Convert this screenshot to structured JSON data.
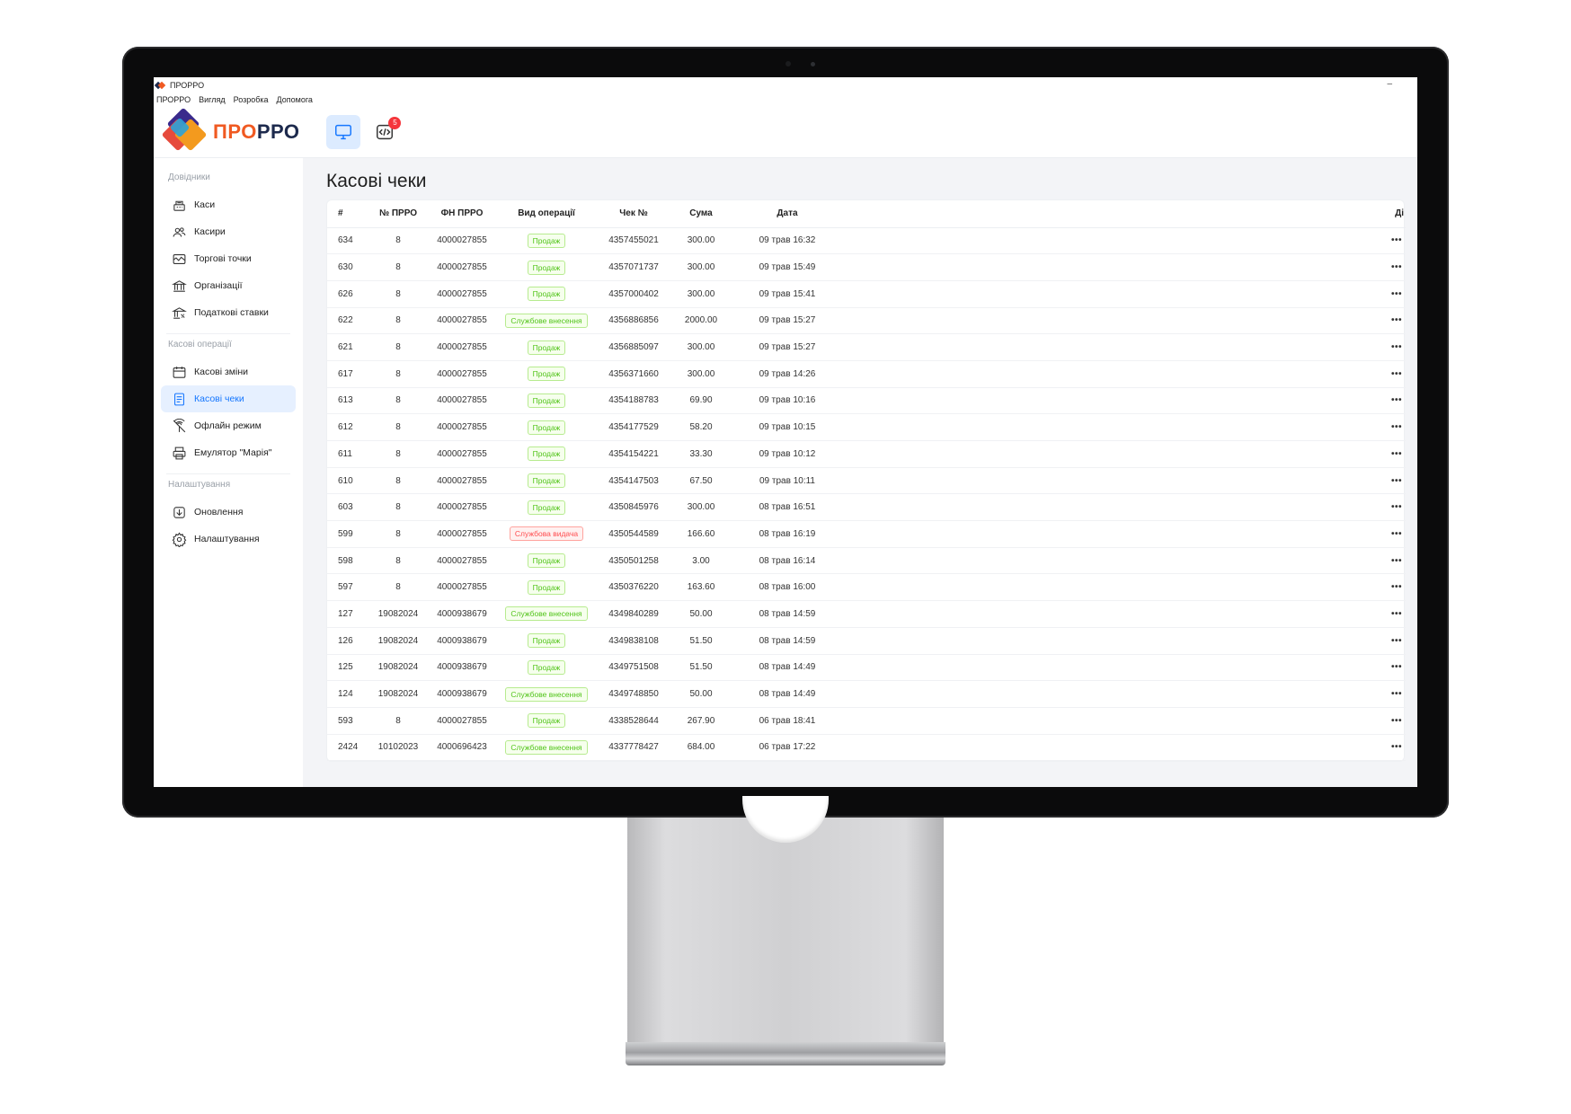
{
  "window": {
    "title": "ПРОРРО",
    "minimize": "–"
  },
  "menu": [
    "ПРОРРО",
    "Вигляд",
    "Розробка",
    "Допомога"
  ],
  "brand": {
    "part1": "ПРО",
    "part2": "РРО"
  },
  "header": {
    "notifications_count": "5"
  },
  "sidebar": {
    "groups": [
      {
        "label": "Довідники",
        "items": [
          {
            "label": "Каси",
            "icon": "cash-register-icon"
          },
          {
            "label": "Касири",
            "icon": "users-icon"
          },
          {
            "label": "Торгові точки",
            "icon": "shop-icon"
          },
          {
            "label": "Організації",
            "icon": "bank-icon"
          },
          {
            "label": "Податкові ставки",
            "icon": "tax-icon"
          }
        ]
      },
      {
        "label": "Касові операції",
        "items": [
          {
            "label": "Касові зміни",
            "icon": "calendar-icon"
          },
          {
            "label": "Касові чеки",
            "icon": "receipt-icon",
            "active": true
          },
          {
            "label": "Офлайн режим",
            "icon": "offline-icon"
          },
          {
            "label": "Емулятор \"Марія\"",
            "icon": "printer-icon"
          }
        ]
      },
      {
        "label": "Налаштування",
        "items": [
          {
            "label": "Оновлення",
            "icon": "download-icon"
          },
          {
            "label": "Налаштування",
            "icon": "gear-icon"
          }
        ]
      }
    ]
  },
  "main": {
    "title": "Касові чеки"
  },
  "table": {
    "columns": [
      "#",
      "№ ПРРО",
      "ФН ПРРО",
      "Вид операції",
      "Чек №",
      "Сума",
      "Дата",
      "Ді"
    ],
    "rows": [
      [
        "634",
        "8",
        "4000027855",
        "Продаж",
        "4357455021",
        "300.00",
        "09 трав 16:32"
      ],
      [
        "630",
        "8",
        "4000027855",
        "Продаж",
        "4357071737",
        "300.00",
        "09 трав 15:49"
      ],
      [
        "626",
        "8",
        "4000027855",
        "Продаж",
        "4357000402",
        "300.00",
        "09 трав 15:41"
      ],
      [
        "622",
        "8",
        "4000027855",
        "Службове внесення",
        "4356886856",
        "2000.00",
        "09 трав 15:27"
      ],
      [
        "621",
        "8",
        "4000027855",
        "Продаж",
        "4356885097",
        "300.00",
        "09 трав 15:27"
      ],
      [
        "617",
        "8",
        "4000027855",
        "Продаж",
        "4356371660",
        "300.00",
        "09 трав 14:26"
      ],
      [
        "613",
        "8",
        "4000027855",
        "Продаж",
        "4354188783",
        "69.90",
        "09 трав 10:16"
      ],
      [
        "612",
        "8",
        "4000027855",
        "Продаж",
        "4354177529",
        "58.20",
        "09 трав 10:15"
      ],
      [
        "611",
        "8",
        "4000027855",
        "Продаж",
        "4354154221",
        "33.30",
        "09 трав 10:12"
      ],
      [
        "610",
        "8",
        "4000027855",
        "Продаж",
        "4354147503",
        "67.50",
        "09 трав 10:11"
      ],
      [
        "603",
        "8",
        "4000027855",
        "Продаж",
        "4350845976",
        "300.00",
        "08 трав 16:51"
      ],
      [
        "599",
        "8",
        "4000027855",
        "Службова видача",
        "4350544589",
        "166.60",
        "08 трав 16:19"
      ],
      [
        "598",
        "8",
        "4000027855",
        "Продаж",
        "4350501258",
        "3.00",
        "08 трав 16:14"
      ],
      [
        "597",
        "8",
        "4000027855",
        "Продаж",
        "4350376220",
        "163.60",
        "08 трав 16:00"
      ],
      [
        "127",
        "19082024",
        "4000938679",
        "Службове внесення",
        "4349840289",
        "50.00",
        "08 трав 14:59"
      ],
      [
        "126",
        "19082024",
        "4000938679",
        "Продаж",
        "4349838108",
        "51.50",
        "08 трав 14:59"
      ],
      [
        "125",
        "19082024",
        "4000938679",
        "Продаж",
        "4349751508",
        "51.50",
        "08 трав 14:49"
      ],
      [
        "124",
        "19082024",
        "4000938679",
        "Службове внесення",
        "4349748850",
        "50.00",
        "08 трав 14:49"
      ],
      [
        "593",
        "8",
        "4000027855",
        "Продаж",
        "4338528644",
        "267.90",
        "06 трав 18:41"
      ],
      [
        "2424",
        "10102023",
        "4000696423",
        "Службове внесення",
        "4337778427",
        "684.00",
        "06 трав 17:22"
      ]
    ],
    "row_action": "•••",
    "tag_colors": {
      "Продаж": "green",
      "Службове внесення": "green",
      "Службова видача": "red"
    }
  },
  "colors": {
    "brand_orange": "#f05a22",
    "brand_navy": "#1d2a4d",
    "accent": "#1677ff"
  }
}
